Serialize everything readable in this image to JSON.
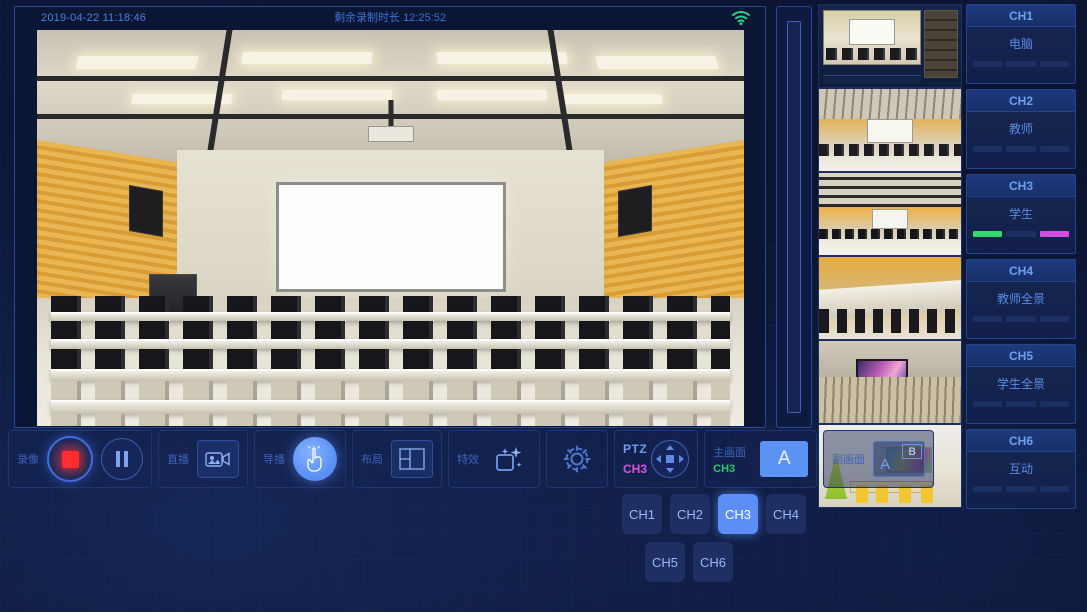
{
  "header": {
    "datetime": "2019-04-22  11:18:46",
    "remaining_label": "剩余录制时长 12:25:52",
    "wifi_icon": "wifi-icon",
    "wifi_color": "#2fcf8a"
  },
  "toolbar": {
    "groups": [
      {
        "label": "录像",
        "buttons": [
          {
            "name": "record-stop-button",
            "icon": "stop-square-icon"
          },
          {
            "name": "pause-button",
            "icon": "pause-icon"
          }
        ]
      },
      {
        "label": "直播",
        "buttons": [
          {
            "name": "live-camera-button",
            "icon": "video-camera-icon"
          }
        ]
      },
      {
        "label": "导播",
        "buttons": [
          {
            "name": "director-button",
            "icon": "hand-touch-icon"
          }
        ]
      },
      {
        "label": "布局",
        "buttons": [
          {
            "name": "layout-button",
            "icon": "layout-split-icon"
          }
        ]
      },
      {
        "label": "特效",
        "buttons": [
          {
            "name": "effects-button",
            "icon": "sparkle-square-icon"
          }
        ]
      },
      {
        "label": "",
        "buttons": [
          {
            "name": "settings-button",
            "icon": "gear-icon"
          }
        ]
      }
    ],
    "ptz": {
      "title": "PTZ",
      "channel": "CH3",
      "channel_color": "#dd4fe0",
      "pad_icon": "dpad-icon"
    },
    "main_scene": {
      "label": "主画面",
      "channel": "CH3",
      "channel_color": "#2fc46a",
      "tile": "A"
    },
    "sub_scene": {
      "label": "副画面",
      "tile_primary": "A",
      "tile_secondary": "B"
    }
  },
  "channel_select": {
    "active": "CH3",
    "row1": [
      "CH1",
      "CH2",
      "CH3",
      "CH4"
    ],
    "row2": [
      "CH5",
      "CH6"
    ]
  },
  "thumbnails": [
    {
      "name": "thumb-ch1-computer",
      "caption": ""
    },
    {
      "name": "thumb-ch2-teacher",
      "caption": ""
    },
    {
      "name": "thumb-ch3-student",
      "caption": ""
    },
    {
      "name": "thumb-ch4-teacher-wide",
      "caption": ""
    },
    {
      "name": "thumb-ch5-student-wide",
      "caption": ""
    },
    {
      "name": "thumb-ch6-interaction",
      "caption": ""
    }
  ],
  "channels": [
    {
      "id": "CH1",
      "name": "电脑",
      "bars": [
        "idle",
        "idle",
        "idle"
      ]
    },
    {
      "id": "CH2",
      "name": "教师",
      "bars": [
        "idle",
        "idle",
        "idle"
      ]
    },
    {
      "id": "CH3",
      "name": "学生",
      "bars": [
        "green",
        "idle",
        "magenta"
      ]
    },
    {
      "id": "CH4",
      "name": "教师全景",
      "bars": [
        "idle",
        "idle",
        "idle"
      ]
    },
    {
      "id": "CH5",
      "name": "学生全景",
      "bars": [
        "idle",
        "idle",
        "idle"
      ]
    },
    {
      "id": "CH6",
      "name": "互动",
      "bars": [
        "idle",
        "idle",
        "idle"
      ]
    }
  ],
  "colors": {
    "background": "#0b1531",
    "accent": "#5d8ef5",
    "panel_border": "#25438f",
    "record_red": "#ff2d2d",
    "green": "#35d66a",
    "magenta": "#d44fe0"
  }
}
